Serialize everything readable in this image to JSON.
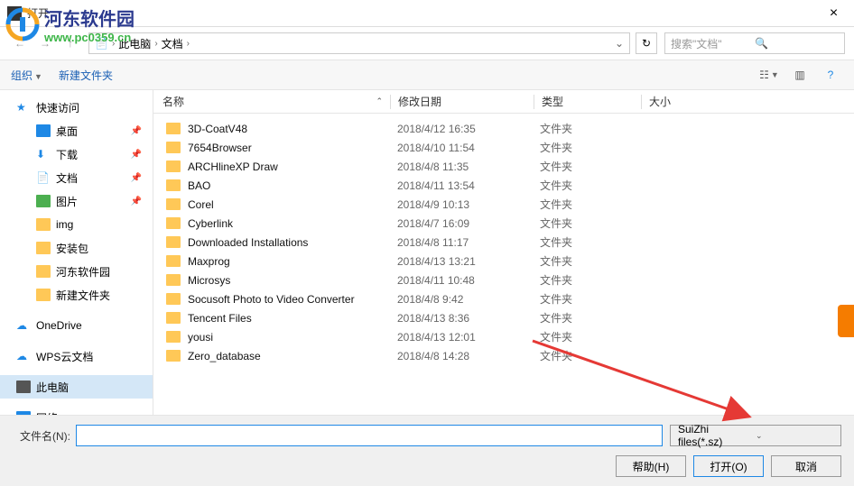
{
  "window": {
    "title": "打开"
  },
  "watermark": {
    "site_name": "河东软件园",
    "site_url": "www.pc0359.cn"
  },
  "breadcrumb": {
    "items": [
      "此电脑",
      "文档"
    ]
  },
  "search": {
    "placeholder": "搜索\"文档\""
  },
  "toolbar": {
    "organize": "组织",
    "new_folder": "新建文件夹"
  },
  "sidebar": {
    "quick_access": "快速访问",
    "items": [
      {
        "label": "桌面",
        "pin": true
      },
      {
        "label": "下载",
        "pin": true
      },
      {
        "label": "文档",
        "pin": true
      },
      {
        "label": "图片",
        "pin": true
      },
      {
        "label": "img"
      },
      {
        "label": "安装包"
      },
      {
        "label": "河东软件园"
      },
      {
        "label": "新建文件夹"
      }
    ],
    "onedrive": "OneDrive",
    "wps": "WPS云文档",
    "this_pc": "此电脑",
    "network": "网络"
  },
  "columns": {
    "name": "名称",
    "date": "修改日期",
    "type": "类型",
    "size": "大小"
  },
  "files": [
    {
      "name": "3D-CoatV48",
      "date": "2018/4/12 16:35",
      "type": "文件夹"
    },
    {
      "name": "7654Browser",
      "date": "2018/4/10 11:54",
      "type": "文件夹"
    },
    {
      "name": "ARCHlineXP Draw",
      "date": "2018/4/8 11:35",
      "type": "文件夹"
    },
    {
      "name": "BAO",
      "date": "2018/4/11 13:54",
      "type": "文件夹"
    },
    {
      "name": "Corel",
      "date": "2018/4/9 10:13",
      "type": "文件夹"
    },
    {
      "name": "Cyberlink",
      "date": "2018/4/7 16:09",
      "type": "文件夹"
    },
    {
      "name": "Downloaded Installations",
      "date": "2018/4/8 11:17",
      "type": "文件夹"
    },
    {
      "name": "Maxprog",
      "date": "2018/4/13 13:21",
      "type": "文件夹"
    },
    {
      "name": "Microsys",
      "date": "2018/4/11 10:48",
      "type": "文件夹"
    },
    {
      "name": "Socusoft Photo to Video Converter",
      "date": "2018/4/8 9:42",
      "type": "文件夹"
    },
    {
      "name": "Tencent Files",
      "date": "2018/4/13 8:36",
      "type": "文件夹"
    },
    {
      "name": "yousi",
      "date": "2018/4/13 12:01",
      "type": "文件夹"
    },
    {
      "name": "Zero_database",
      "date": "2018/4/8 14:28",
      "type": "文件夹"
    }
  ],
  "footer": {
    "filename_label": "文件名(N):",
    "filename_value": "",
    "filetype": "SuiZhi files(*.sz)",
    "help": "帮助(H)",
    "open": "打开(O)",
    "cancel": "取消"
  }
}
